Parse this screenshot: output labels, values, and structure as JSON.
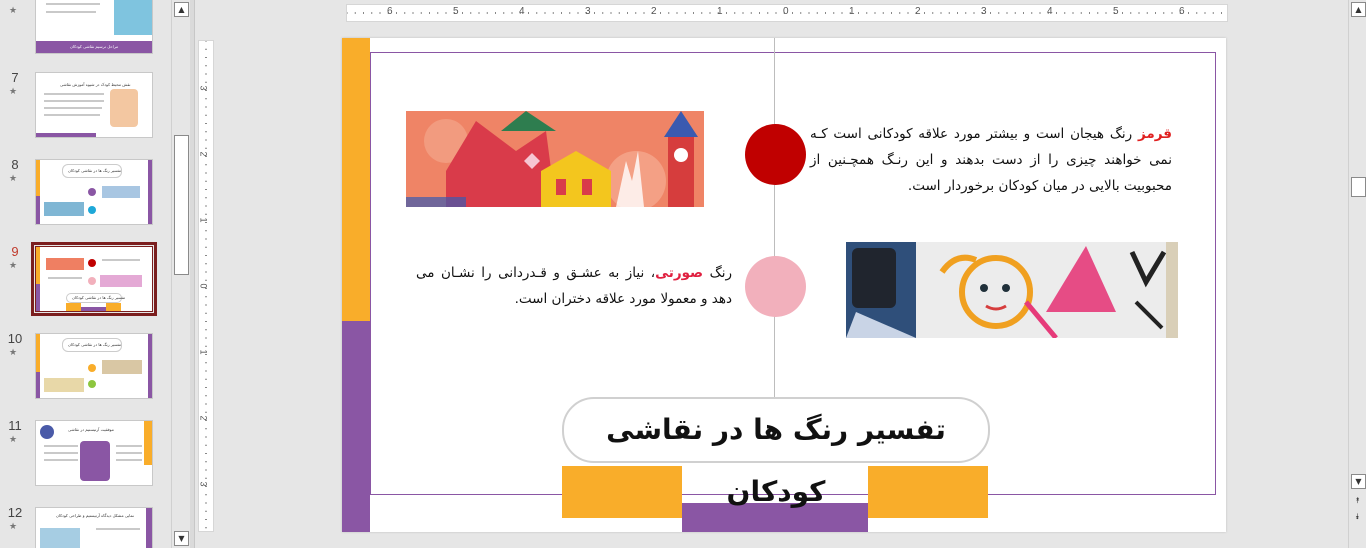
{
  "thumbnails": [
    {
      "number": "",
      "starred": false,
      "caption": "مراحل ترسیم نقاشی کودکان",
      "selected": false
    },
    {
      "number": "7",
      "starred": true,
      "caption": "نقش محیط کودک در شیوه آموزش نقاشی",
      "selected": false
    },
    {
      "number": "8",
      "starred": true,
      "caption": "تفسیر رنگ ها در نقاشی کودکان",
      "selected": false
    },
    {
      "number": "9",
      "starred": true,
      "caption": "تفسیر رنگ ها در نقاشی کودکان",
      "selected": true
    },
    {
      "number": "10",
      "starred": true,
      "caption": "تفسیر رنگ ها در نقاشی کودکان",
      "selected": false
    },
    {
      "number": "11",
      "starred": true,
      "caption": "موفقیت آرتیستیم در نقاشی",
      "selected": false
    },
    {
      "number": "12",
      "starred": true,
      "caption": "نمایی مشکل دیدگاه آرتیستیم و طراحی کودکان",
      "selected": false
    }
  ],
  "star_glyph": "★",
  "scroll": {
    "up": "▲",
    "down": "▼",
    "prev_slide": "⯭",
    "next_slide": "⯯"
  },
  "ruler": {
    "h_labels": [
      "6",
      "5",
      "4",
      "3",
      "2",
      "1",
      "0",
      "1",
      "2",
      "3",
      "4",
      "5",
      "6"
    ],
    "v_labels": [
      "3",
      "2",
      "1",
      "0",
      "1",
      "2",
      "3"
    ]
  },
  "slide": {
    "title": "تفسیر رنگ ها در نقاشی کودکان",
    "red_item": {
      "highlight": "قرمز",
      "text": " رنگ هیجان است و بیشتر مورد علاقه کودکانی است کـه نمی خواهند چیزی را از دست بدهند و این رنـگ همچـنین از محبوبیت بالایی در میان کودکان برخوردار است.",
      "dot_color": "#c00000"
    },
    "pink_item": {
      "prefix": "رنگ ",
      "highlight": "صورتی",
      "text": "، نیاز به عشـق و قـدردانی را نشـان می دهد و معمولا مورد علاقه دختران است.",
      "dot_color": "#f2b0bc"
    },
    "colors": {
      "orange": "#f9ad2a",
      "purple": "#8a56a4",
      "red": "#c00000",
      "pink": "#f2b0bc"
    }
  }
}
